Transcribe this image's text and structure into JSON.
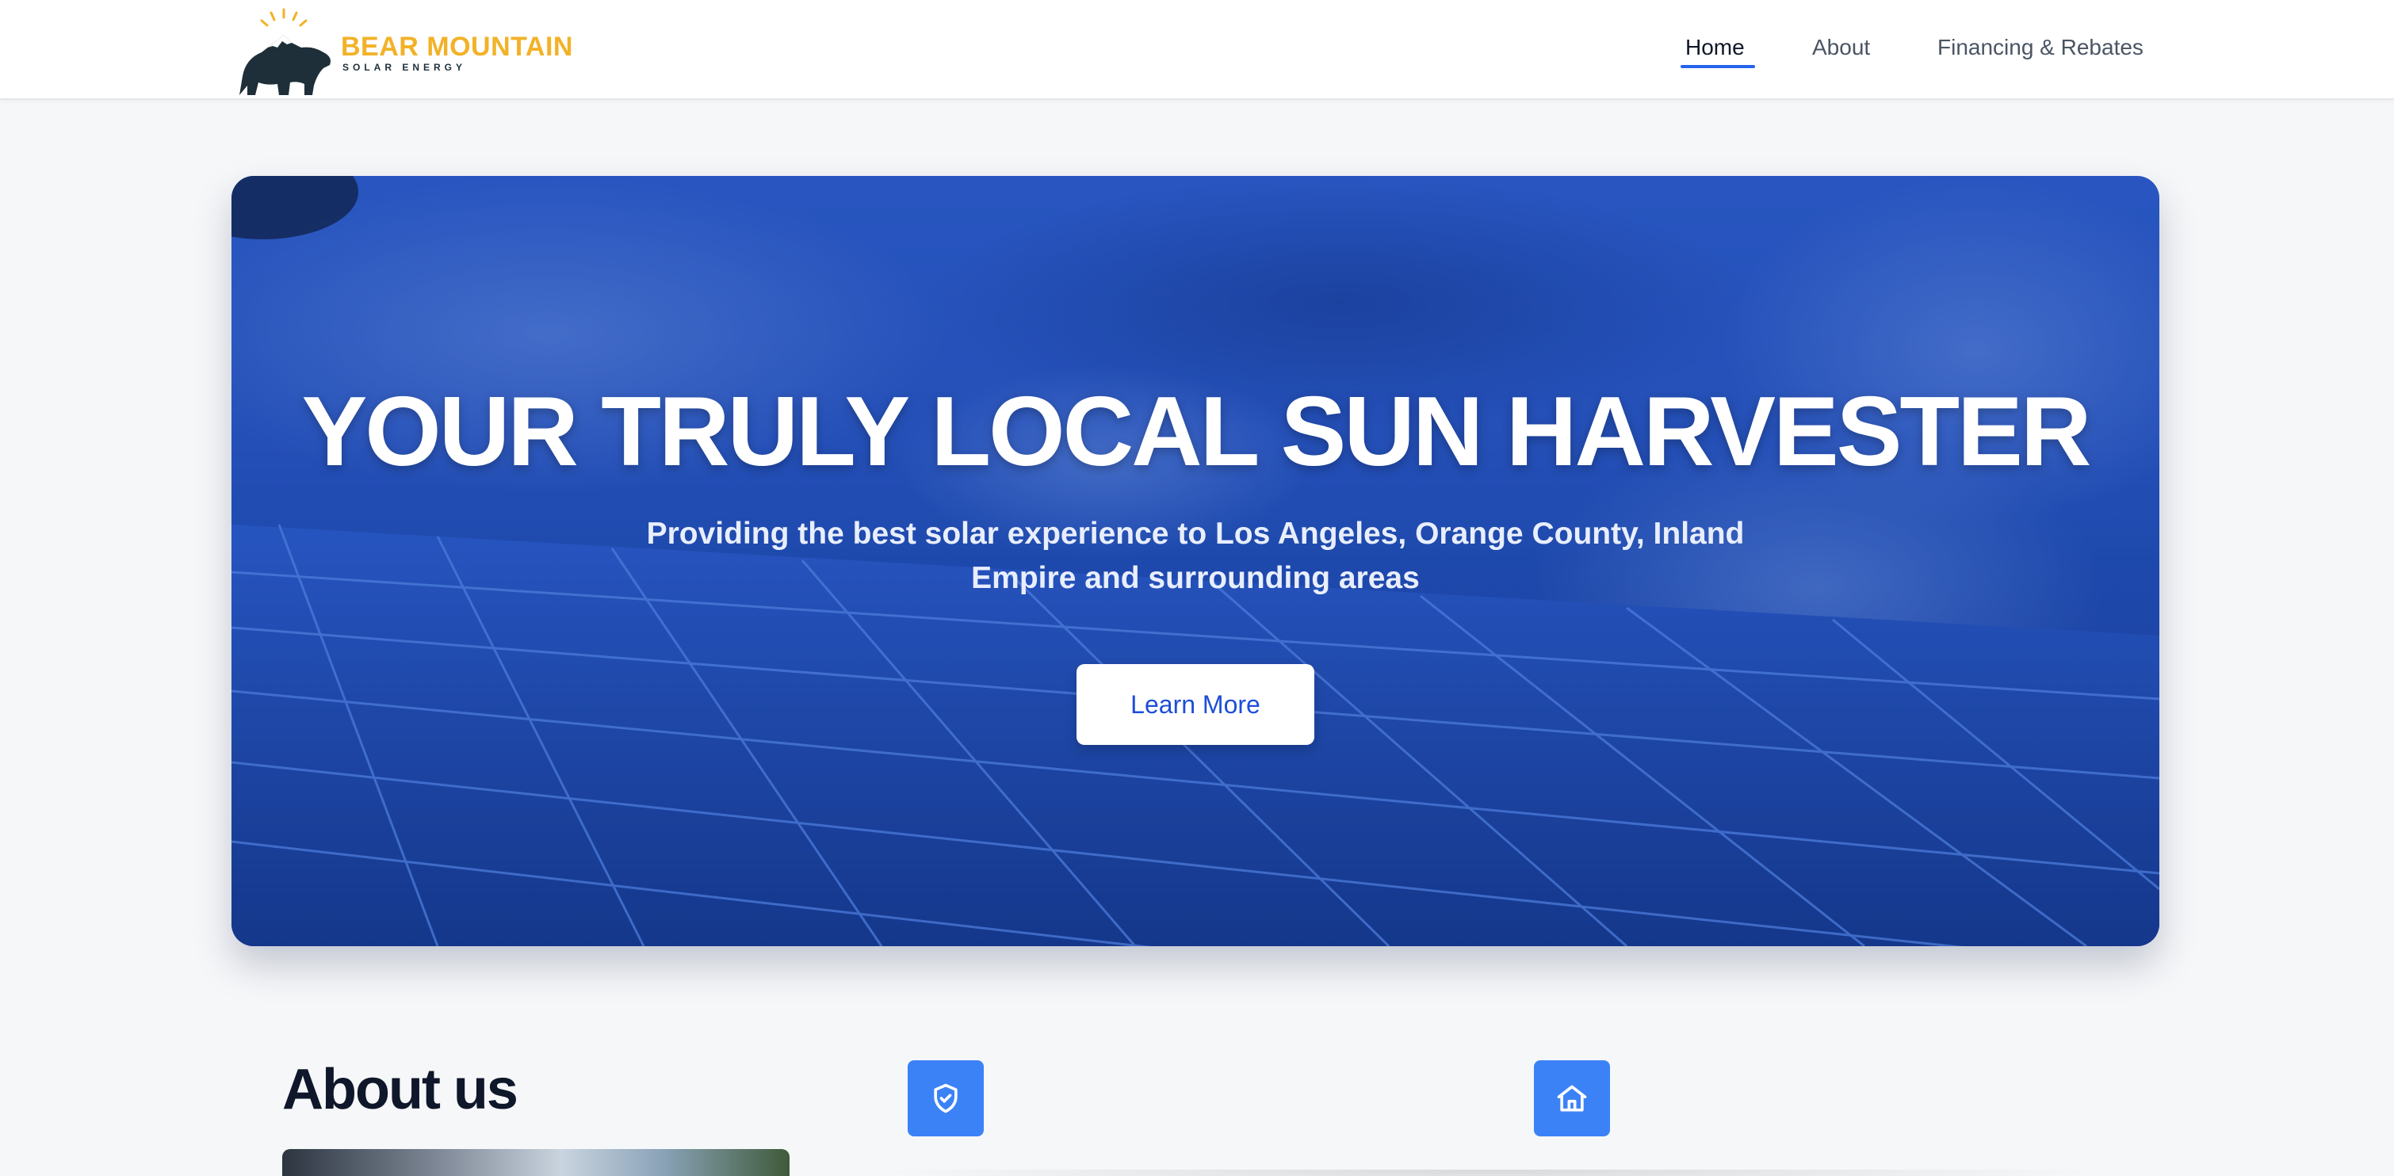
{
  "header": {
    "logo": {
      "brand_name": "BEAR MOUNTAIN",
      "brand_tagline": "SOLAR ENERGY",
      "icon": "bear-mountain-sun-logo"
    },
    "nav": [
      {
        "label": "Home",
        "active": true
      },
      {
        "label": "About",
        "active": false
      },
      {
        "label": "Financing & Rebates",
        "active": false
      }
    ]
  },
  "hero": {
    "title": "YOUR TRULY LOCAL SUN HARVESTER",
    "subtitle": "Providing the best solar experience to Los Angeles, Orange County, Inland Empire and surrounding areas",
    "cta_label": "Learn More",
    "background": "solar-panels-under-blue-sky"
  },
  "about": {
    "title": "About us",
    "features": [
      {
        "icon": "shield-check-icon"
      },
      {
        "icon": "home-icon"
      }
    ]
  },
  "colors": {
    "accent": "#2563eb",
    "brand_gold": "#f2b227",
    "hero_blue": "#1d4ed8",
    "icon_tile": "#3b82f6"
  }
}
